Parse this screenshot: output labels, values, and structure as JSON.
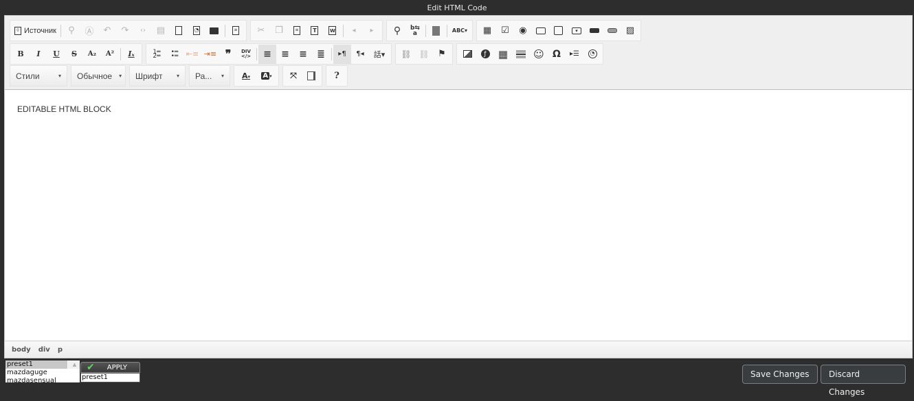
{
  "window": {
    "title": "Edit HTML Code"
  },
  "toolbar": {
    "source_label": "Источник",
    "row1": [
      {
        "name": "find-icon",
        "glyph": "⚲",
        "disabled": true
      },
      {
        "name": "select-all-icon",
        "glyph": "Ⓐ",
        "disabled": true
      },
      {
        "name": "undo-icon",
        "glyph": "↶",
        "disabled": true
      },
      {
        "name": "redo-icon",
        "glyph": "↷",
        "disabled": true
      },
      {
        "name": "code-snippet-icon",
        "glyph": "‹›",
        "disabled": true
      },
      {
        "name": "save-icon",
        "glyph": "▤",
        "disabled": true
      },
      {
        "name": "new-page-icon",
        "glyph": "🗋",
        "disabled": false
      },
      {
        "name": "preview-icon",
        "glyph": "🔍",
        "disabled": false
      },
      {
        "name": "print-icon",
        "glyph": "⎙",
        "disabled": false
      },
      {
        "name": "templates-icon",
        "glyph": "▤",
        "disabled": false
      }
    ],
    "clipboard": [
      {
        "name": "cut-icon",
        "glyph": "✂",
        "disabled": true
      },
      {
        "name": "copy-icon",
        "glyph": "❐",
        "disabled": true
      },
      {
        "name": "paste-icon",
        "glyph": "📋",
        "disabled": false
      },
      {
        "name": "paste-text-icon",
        "glyph": "T",
        "disabled": false
      },
      {
        "name": "paste-word-icon",
        "glyph": "W",
        "disabled": false
      },
      {
        "name": "nav-prev-icon",
        "glyph": "◂",
        "disabled": true
      },
      {
        "name": "nav-next-icon",
        "glyph": "▸",
        "disabled": true
      }
    ],
    "search": [
      {
        "name": "search-icon",
        "glyph": "🔍"
      },
      {
        "name": "replace-icon",
        "glyph": "⇄"
      },
      {
        "name": "show-blocks-icon",
        "glyph": "▚"
      },
      {
        "name": "spellcheck-icon",
        "glyph": "ABC▾"
      }
    ],
    "forms": [
      {
        "name": "form-icon",
        "glyph": "▦"
      },
      {
        "name": "checkbox-icon",
        "glyph": "☑"
      },
      {
        "name": "radio-icon",
        "glyph": "◉"
      },
      {
        "name": "textfield-icon",
        "glyph": "▭"
      },
      {
        "name": "textarea-icon",
        "glyph": "◱"
      },
      {
        "name": "select-icon",
        "glyph": "▾"
      },
      {
        "name": "button-icon",
        "glyph": "▬"
      },
      {
        "name": "image-button-icon",
        "glyph": "▭"
      },
      {
        "name": "hidden-field-icon",
        "glyph": "▨"
      }
    ],
    "basic": [
      {
        "name": "bold-icon",
        "glyph": "B"
      },
      {
        "name": "italic-icon",
        "glyph": "I"
      },
      {
        "name": "underline-icon",
        "glyph": "U"
      },
      {
        "name": "strike-icon",
        "glyph": "S"
      },
      {
        "name": "subscript-icon",
        "glyph": "A₂"
      },
      {
        "name": "superscript-icon",
        "glyph": "A²"
      },
      {
        "name": "remove-format-icon",
        "glyph": "Iₓ"
      }
    ],
    "paragraph": [
      {
        "name": "numbered-list-icon",
        "glyph": "⒈"
      },
      {
        "name": "bulleted-list-icon",
        "glyph": "☰"
      },
      {
        "name": "outdent-icon",
        "glyph": "⇤",
        "disabled": true
      },
      {
        "name": "indent-icon",
        "glyph": "⇥"
      },
      {
        "name": "blockquote-icon",
        "glyph": "❞"
      },
      {
        "name": "div-icon",
        "glyph": "DIV"
      },
      {
        "name": "align-left-icon",
        "glyph": "≡",
        "active": true
      },
      {
        "name": "align-center-icon",
        "glyph": "≡"
      },
      {
        "name": "align-right-icon",
        "glyph": "≡"
      },
      {
        "name": "align-justify-icon",
        "glyph": "≣"
      },
      {
        "name": "ltr-icon",
        "glyph": "▸¶",
        "active": true
      },
      {
        "name": "rtl-icon",
        "glyph": "¶◂"
      },
      {
        "name": "language-icon",
        "glyph": "話▾"
      }
    ],
    "links": [
      {
        "name": "link-icon",
        "glyph": "🔗"
      },
      {
        "name": "unlink-icon",
        "glyph": "⛓",
        "disabled": true
      },
      {
        "name": "anchor-icon",
        "glyph": "⚑"
      }
    ],
    "insert": [
      {
        "name": "image-icon",
        "glyph": "🖼"
      },
      {
        "name": "flash-icon",
        "glyph": "⊘"
      },
      {
        "name": "table-icon",
        "glyph": "▦"
      },
      {
        "name": "horizontal-rule-icon",
        "glyph": "☰"
      },
      {
        "name": "smiley-icon",
        "glyph": "☺"
      },
      {
        "name": "special-char-icon",
        "glyph": "Ω"
      },
      {
        "name": "page-break-icon",
        "glyph": "⇥"
      },
      {
        "name": "iframe-icon",
        "glyph": "🌐"
      }
    ],
    "styles_label": "Стили",
    "format_label": "Обычное",
    "font_label": "Шрифт",
    "size_label": "Ра...",
    "colors": [
      {
        "name": "text-color-icon",
        "glyph": "A▾"
      },
      {
        "name": "bg-color-icon",
        "glyph": "A▾"
      }
    ],
    "tools": [
      {
        "name": "maximize-icon",
        "glyph": "⛶"
      },
      {
        "name": "show-blocks-icon",
        "glyph": "▯"
      }
    ],
    "help_glyph": "?"
  },
  "content": {
    "text": "EDITABLE HTML BLOCK"
  },
  "pathbar": {
    "items": [
      "body",
      "div",
      "p"
    ]
  },
  "presets": {
    "list": [
      "preset1",
      "mazdaguge",
      "mazdasensual"
    ],
    "selected": "preset1",
    "apply_label": "APPLY",
    "input_value": "preset1"
  },
  "actions": {
    "save_label": "Save Changes",
    "discard_label": "Discard Changes"
  }
}
